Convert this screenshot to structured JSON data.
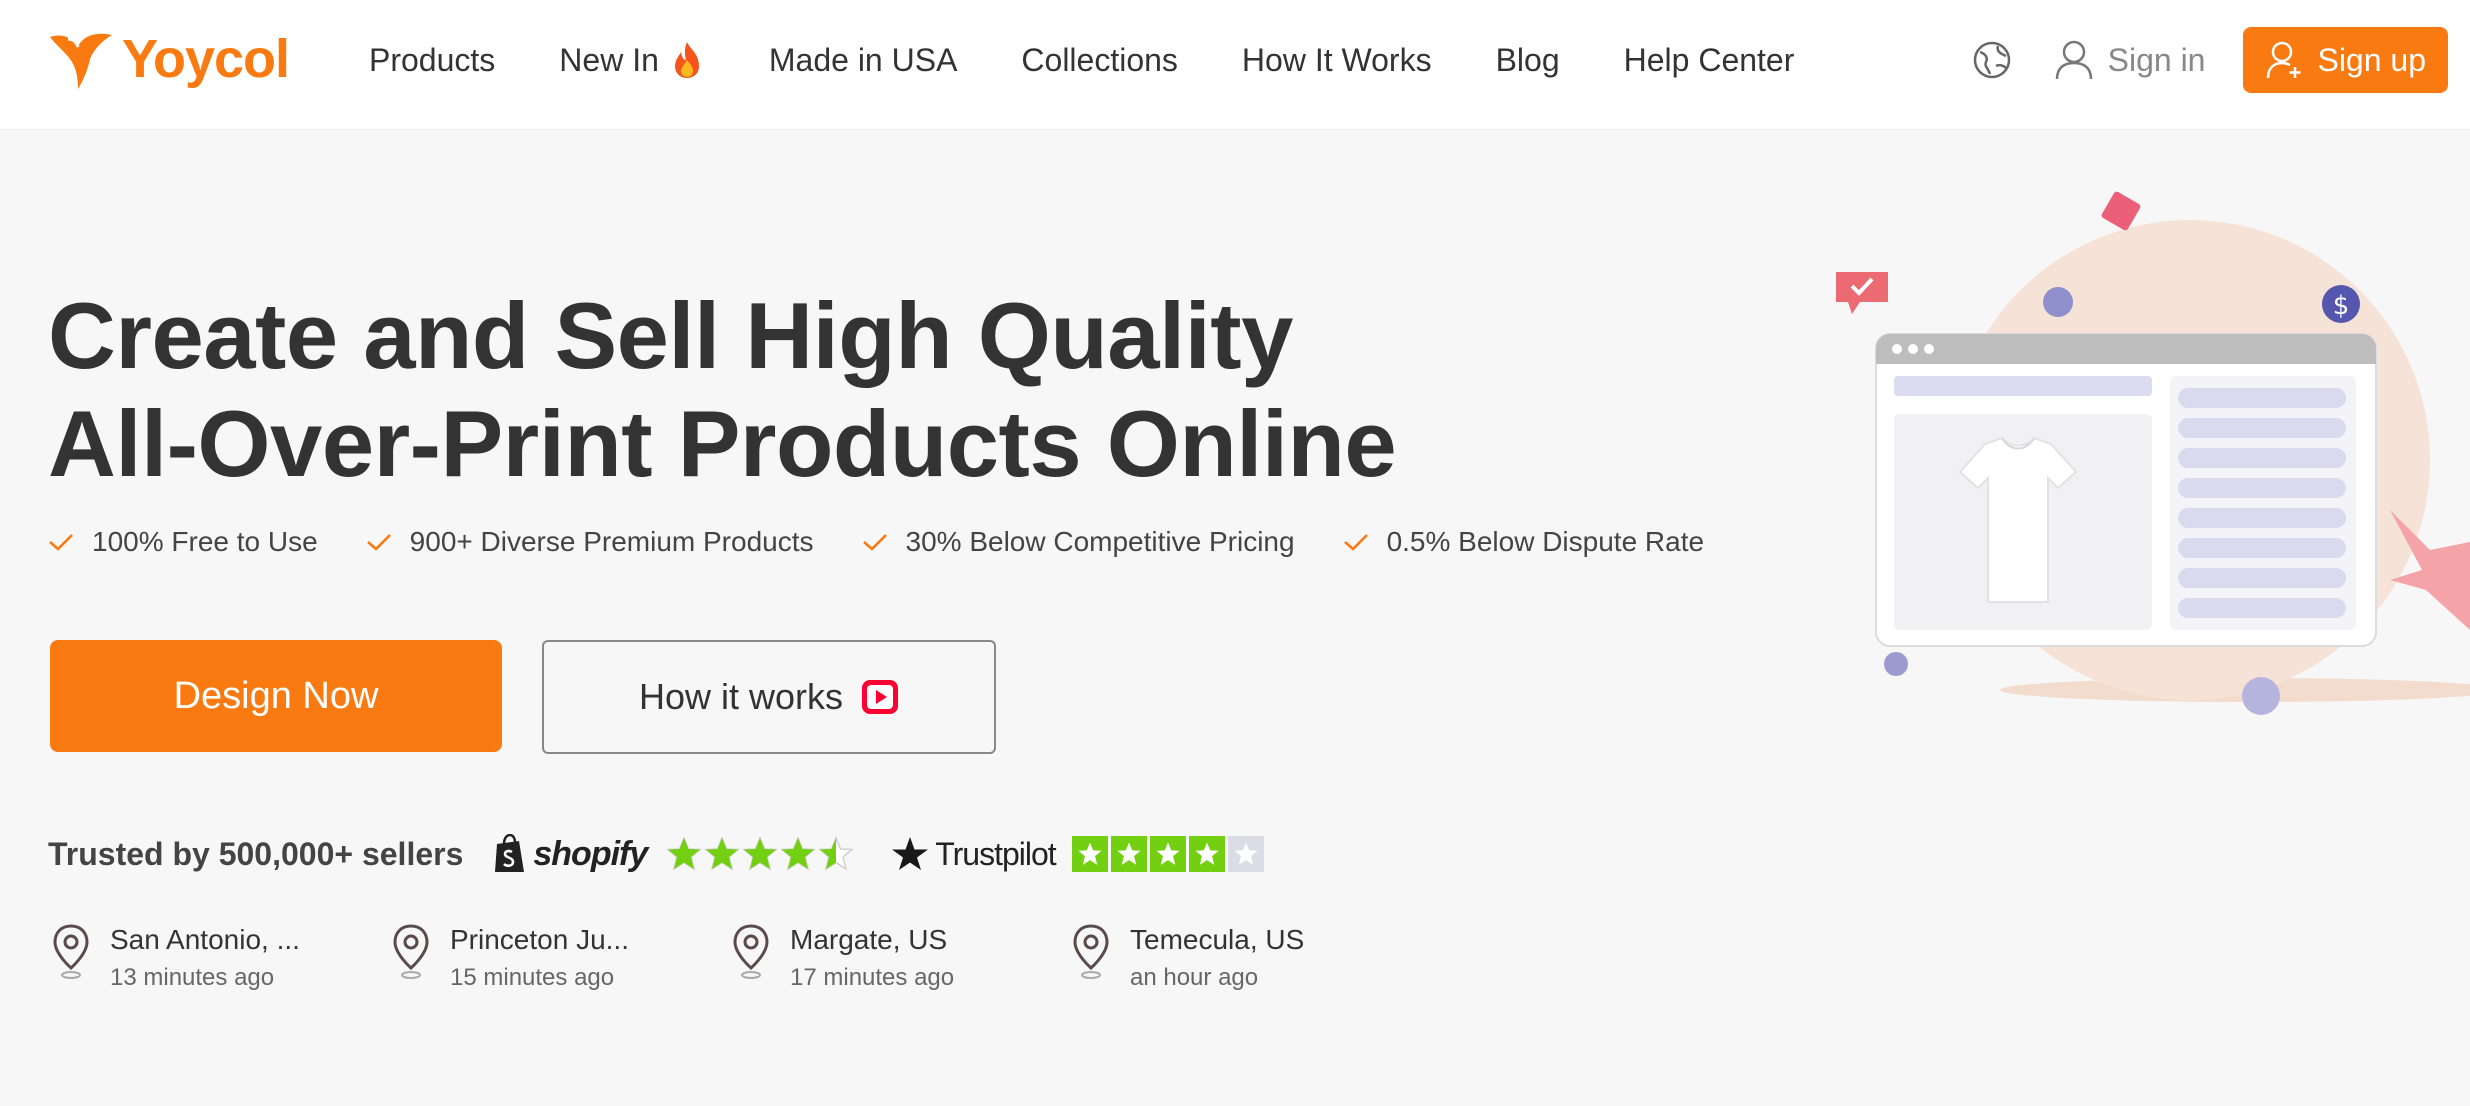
{
  "brand": {
    "name": "Yoycol",
    "color": "#fa7a12"
  },
  "nav": {
    "items": [
      {
        "label": "Products"
      },
      {
        "label": "New In",
        "icon": "fire-icon"
      },
      {
        "label": "Made in USA"
      },
      {
        "label": "Collections"
      },
      {
        "label": "How It Works"
      },
      {
        "label": "Blog"
      },
      {
        "label": "Help Center"
      }
    ],
    "language_icon": "globe-icon",
    "signin_label": "Sign in",
    "signup_label": "Sign up"
  },
  "hero": {
    "title_line1": "Create and Sell High Quality",
    "title_line2": "All-Over-Print Products Online",
    "features": [
      "100% Free to Use",
      "900+ Diverse Premium Products",
      "30% Below Competitive Pricing",
      "0.5% Below Dispute Rate"
    ],
    "primary_button": "Design Now",
    "secondary_button": "How it works"
  },
  "trust": {
    "text": "Trusted by 500,000+ sellers",
    "shopify_label": "shopify",
    "shopify_rating": 4.5,
    "trustpilot_label": "Trustpilot",
    "trustpilot_rating": 4
  },
  "activity": [
    {
      "city": "San Antonio, ...",
      "time": "13 minutes ago"
    },
    {
      "city": "Princeton Ju...",
      "time": "15 minutes ago"
    },
    {
      "city": "Margate, US",
      "time": "17 minutes ago"
    },
    {
      "city": "Temecula, US",
      "time": "an hour ago"
    }
  ],
  "colors": {
    "accent": "#fa7a12",
    "text_dark": "#333333",
    "rating_green": "#73cf11",
    "youtube_red": "#ff0033"
  }
}
